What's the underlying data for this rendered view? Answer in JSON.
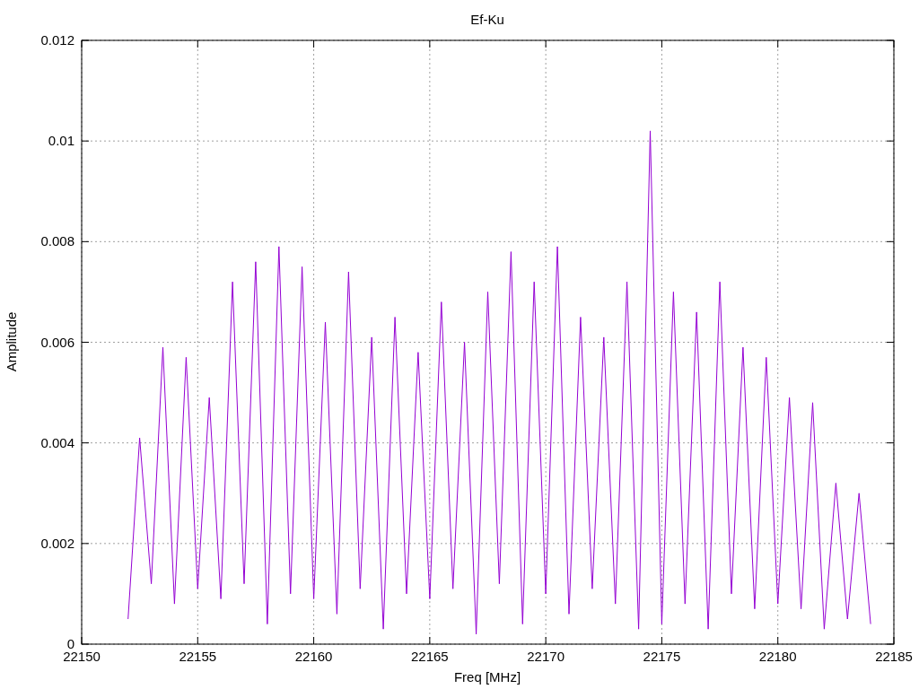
{
  "chart_data": {
    "type": "line",
    "title": "Ef-Ku",
    "xlabel": "Freq [MHz]",
    "ylabel": "Amplitude",
    "xlim": [
      22150,
      22185
    ],
    "ylim": [
      0,
      0.012
    ],
    "grid": true,
    "xticks": [
      22150,
      22155,
      22160,
      22165,
      22170,
      22175,
      22180,
      22185
    ],
    "yticks": [
      0,
      0.002,
      0.004,
      0.006,
      0.008,
      0.01,
      0.012
    ],
    "x": [
      22152,
      22152.5,
      22153,
      22153.5,
      22154,
      22154.5,
      22155,
      22155.5,
      22156,
      22156.5,
      22157,
      22157.5,
      22158,
      22158.5,
      22159,
      22159.5,
      22160,
      22160.5,
      22161,
      22161.5,
      22162,
      22162.5,
      22163,
      22163.5,
      22164,
      22164.5,
      22165,
      22165.5,
      22166,
      22166.5,
      22167,
      22167.5,
      22168,
      22168.5,
      22169,
      22169.5,
      22170,
      22170.5,
      22171,
      22171.5,
      22172,
      22172.5,
      22173,
      22173.5,
      22174,
      22174.5,
      22175,
      22175.5,
      22176,
      22176.5,
      22177,
      22177.5,
      22178,
      22178.5,
      22179,
      22179.5,
      22180,
      22180.5,
      22181,
      22181.5,
      22182,
      22182.5,
      22183,
      22183.5,
      22184
    ],
    "series": [
      {
        "color": "#9400d3",
        "values": [
          0.0005,
          0.0041,
          0.0012,
          0.0059,
          0.0008,
          0.0057,
          0.0011,
          0.0049,
          0.0009,
          0.0072,
          0.0012,
          0.0076,
          0.0004,
          0.0079,
          0.001,
          0.0075,
          0.0009,
          0.0064,
          0.0006,
          0.0074,
          0.0011,
          0.0061,
          0.0003,
          0.0065,
          0.001,
          0.0058,
          0.0009,
          0.0068,
          0.0011,
          0.006,
          0.0002,
          0.007,
          0.0012,
          0.0078,
          0.0004,
          0.0072,
          0.001,
          0.0079,
          0.0006,
          0.0065,
          0.0011,
          0.0061,
          0.0008,
          0.0072,
          0.0003,
          0.0102,
          0.0004,
          0.007,
          0.0008,
          0.0066,
          0.0003,
          0.0072,
          0.001,
          0.0059,
          0.0007,
          0.0057,
          0.0008,
          0.0049,
          0.0007,
          0.0048,
          0.0003,
          0.0032,
          0.0005,
          0.003,
          0.0004
        ]
      }
    ]
  }
}
